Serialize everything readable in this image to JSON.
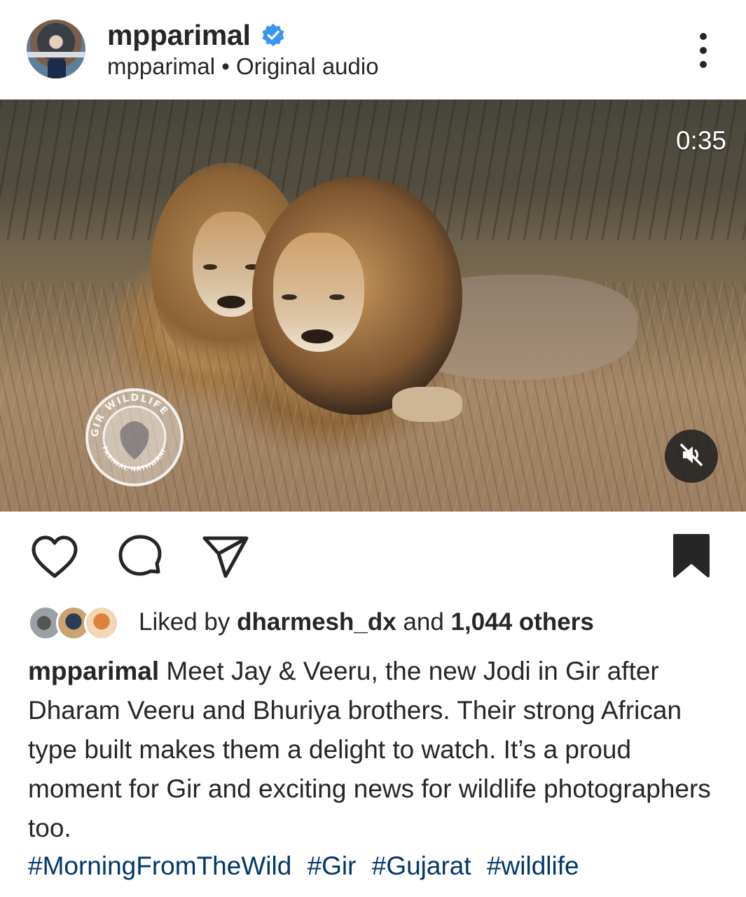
{
  "post": {
    "username": "mpparimal",
    "audio_owner": "mpparimal",
    "separator": "•",
    "audio_label": "Original audio",
    "icons": {
      "verified": "verified-badge-icon",
      "more": "more-options-icon"
    }
  },
  "media": {
    "duration": "0:35",
    "mute_icon": "speaker-muted-icon",
    "watermark_text": "GIR WILDLIFE",
    "watermark_subtext": "PARIMAL NATHWANI"
  },
  "actions": {
    "like_icon": "heart-icon",
    "comment_icon": "comment-icon",
    "share_icon": "send-icon",
    "save_icon": "bookmark-icon"
  },
  "likes": {
    "prefix": "Liked by",
    "liker": "dharmesh_dx",
    "and": "and",
    "others": "1,044 others"
  },
  "caption": {
    "username": "mpparimal",
    "text": "Meet Jay & Veeru, the new Jodi in Gir after Dharam Veeru and Bhuriya brothers. Their strong African type built makes them a delight to watch. It’s a proud moment for Gir and exciting news for wildlife photographers too.",
    "hashtags": [
      "#MorningFromTheWild",
      "#Gir",
      "#Gujarat",
      "#wildlife"
    ]
  },
  "colors": {
    "text": "#262626",
    "hashtag": "#00376b",
    "verified": "#3897f0"
  }
}
